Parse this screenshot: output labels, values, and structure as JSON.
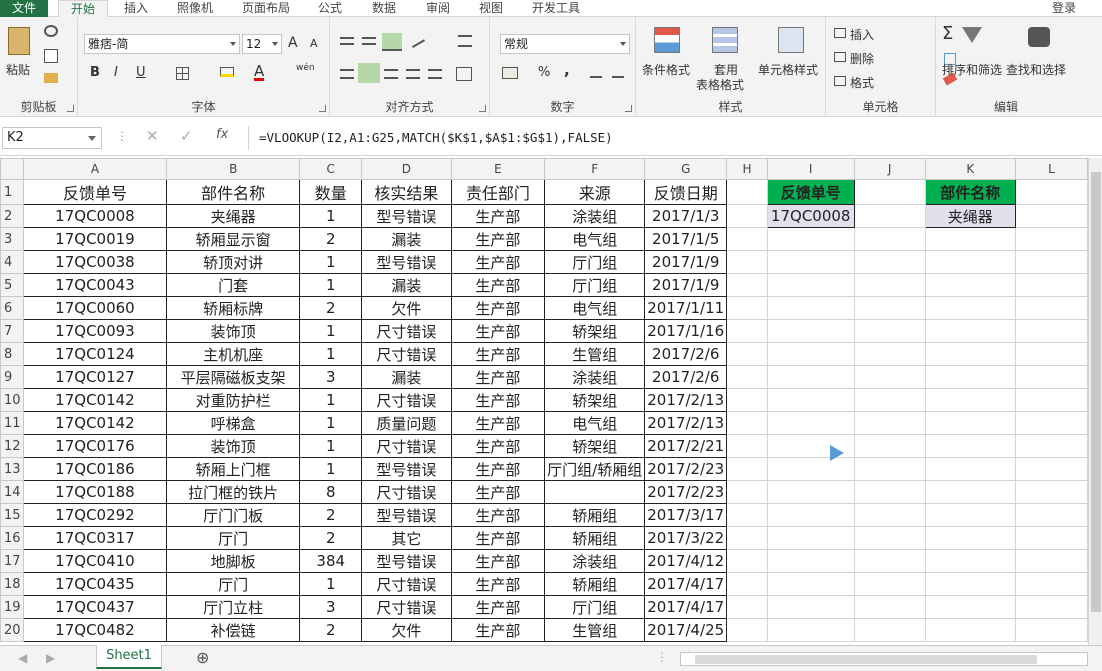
{
  "tabs": [
    "文件",
    "开始",
    "插入",
    "照像机",
    "页面布局",
    "公式",
    "数据",
    "审阅",
    "视图",
    "开发工具"
  ],
  "login": "登录",
  "ribbon": {
    "clipboard": {
      "label": "剪贴板",
      "paste": "粘贴"
    },
    "font": {
      "label": "字体",
      "name": "雅痞-简",
      "size": "12",
      "bold": "B",
      "italic": "I",
      "underline": "U",
      "wen": "wén"
    },
    "align": {
      "label": "对齐方式"
    },
    "number": {
      "label": "数字",
      "format": "常规",
      "percent": "%",
      "comma": ","
    },
    "styles": {
      "label": "样式",
      "cond": "条件格式",
      "table1": "套用",
      "table2": "表格格式",
      "cell": "单元格样式"
    },
    "cells": {
      "label": "单元格",
      "insert": "插入",
      "delete": "删除",
      "format": "格式"
    },
    "edit": {
      "label": "编辑",
      "sort": "排序和筛选",
      "find": "查找和选择",
      "sigma": "Σ"
    }
  },
  "formula_bar": {
    "namebox": "K2",
    "fx": "fx",
    "formula": "=VLOOKUP(I2,A1:G25,MATCH($K$1,$A$1:$G$1),FALSE)"
  },
  "columns": [
    "A",
    "B",
    "C",
    "D",
    "E",
    "F",
    "G",
    "H",
    "I",
    "J",
    "K",
    "L"
  ],
  "headers": [
    "反馈单号",
    "部件名称",
    "数量",
    "核实结果",
    "责任部门",
    "来源",
    "反馈日期"
  ],
  "rows": [
    [
      "17QC0008",
      "夹绳器",
      "1",
      "型号错误",
      "生产部",
      "涂装组",
      "2017/1/3"
    ],
    [
      "17QC0019",
      "轿厢显示窗",
      "2",
      "漏装",
      "生产部",
      "电气组",
      "2017/1/5"
    ],
    [
      "17QC0038",
      "轿顶对讲",
      "1",
      "型号错误",
      "生产部",
      "厅门组",
      "2017/1/9"
    ],
    [
      "17QC0043",
      "门套",
      "1",
      "漏装",
      "生产部",
      "厅门组",
      "2017/1/9"
    ],
    [
      "17QC0060",
      "轿厢标牌",
      "2",
      "欠件",
      "生产部",
      "电气组",
      "2017/1/11"
    ],
    [
      "17QC0093",
      "装饰顶",
      "1",
      "尺寸错误",
      "生产部",
      "轿架组",
      "2017/1/16"
    ],
    [
      "17QC0124",
      "主机机座",
      "1",
      "尺寸错误",
      "生产部",
      "生管组",
      "2017/2/6"
    ],
    [
      "17QC0127",
      "平层隔磁板支架",
      "3",
      "漏装",
      "生产部",
      "涂装组",
      "2017/2/6"
    ],
    [
      "17QC0142",
      "对重防护栏",
      "1",
      "尺寸错误",
      "生产部",
      "轿架组",
      "2017/2/13"
    ],
    [
      "17QC0142",
      "呼梯盒",
      "1",
      "质量问题",
      "生产部",
      "电气组",
      "2017/2/13"
    ],
    [
      "17QC0176",
      "装饰顶",
      "1",
      "尺寸错误",
      "生产部",
      "轿架组",
      "2017/2/21"
    ],
    [
      "17QC0186",
      "轿厢上门框",
      "1",
      "型号错误",
      "生产部",
      "厅门组/轿厢组",
      "2017/2/23"
    ],
    [
      "17QC0188",
      "拉门框的铁片",
      "8",
      "尺寸错误",
      "生产部",
      "",
      "2017/2/23"
    ],
    [
      "17QC0292",
      "厅门门板",
      "2",
      "型号错误",
      "生产部",
      "轿厢组",
      "2017/3/17"
    ],
    [
      "17QC0317",
      "厅门",
      "2",
      "其它",
      "生产部",
      "轿厢组",
      "2017/3/22"
    ],
    [
      "17QC0410",
      "地脚板",
      "384",
      "型号错误",
      "生产部",
      "涂装组",
      "2017/4/12"
    ],
    [
      "17QC0435",
      "厅门",
      "1",
      "尺寸错误",
      "生产部",
      "轿厢组",
      "2017/4/17"
    ],
    [
      "17QC0437",
      "厅门立柱",
      "3",
      "尺寸错误",
      "生产部",
      "厅门组",
      "2017/4/17"
    ],
    [
      "17QC0482",
      "补偿链",
      "2",
      "欠件",
      "生产部",
      "生管组",
      "2017/4/25"
    ]
  ],
  "lookup": {
    "i1": "反馈单号",
    "i2": "17QC0008",
    "k1": "部件名称",
    "k2": "夹绳器"
  },
  "sheet": "Sheet1",
  "colors": {
    "accent": "#217346",
    "header_fill": "#00b050",
    "result_fill": "#e4dfec"
  }
}
